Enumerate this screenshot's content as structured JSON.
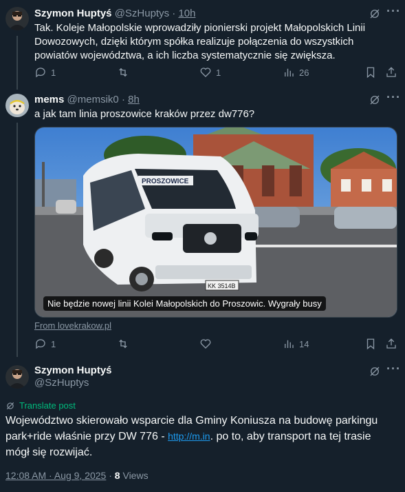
{
  "tweets": [
    {
      "name": "Szymon Huptyś",
      "handle": "@SzHuptys",
      "time": "10h",
      "text": "Tak. Koleje Małopolskie wprowadziły pionierski projekt Małopolskich Linii Dowozowych, dzięki którym spółka realizuje połączenia do wszystkich powiatów województwa, a ich liczba systematycznie się zwiększa.",
      "replies": "1",
      "retweets": "",
      "likes": "1",
      "views": "26"
    },
    {
      "name": "mems",
      "handle": "@memsik0",
      "time": "8h",
      "text": "a jak tam linia proszowice kraków przez dw776?",
      "media_caption": "Nie będzie nowej linii Kolei Małopolskich do Proszowic. Wygrały busy",
      "media_source": "From lovekrakow.pl",
      "plate": "KK 3514B",
      "bus_sign": "PROSZOWICE",
      "replies": "1",
      "retweets": "",
      "likes": "",
      "views": "14"
    }
  ],
  "main_post": {
    "name": "Szymon Huptyś",
    "handle": "@SzHuptys",
    "translate_label": "Translate post",
    "text_before": "Województwo skierowało wsparcie dla Gminy Koniusza na budowę parkingu park+ride właśnie przy DW 776 - ",
    "link": "http://m.in",
    "text_after": ". po to, aby transport na tej trasie mógł się rozwijać.",
    "timestamp": "12:08 AM · Aug 9, 2025",
    "views_count": "8",
    "views_label": "Views"
  },
  "colors": {
    "background": "#15202b",
    "text": "#f7f9f9",
    "muted": "#8b98a5",
    "accent": "#1d9bf0",
    "translate": "#00ba7c"
  }
}
